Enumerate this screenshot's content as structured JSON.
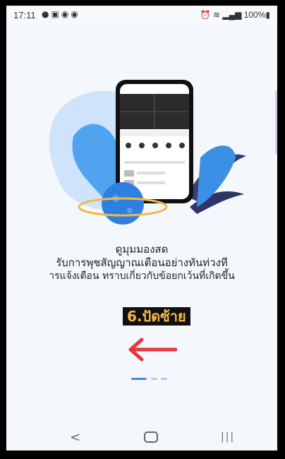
{
  "status_bar": {
    "time": "17:11",
    "left_icons": [
      "chat-icon",
      "gallery-icon",
      "app-icon",
      "app-icon"
    ],
    "right_icons": [
      "alarm-icon",
      "wifi-icon",
      "signal-icon"
    ],
    "battery": "100%"
  },
  "onboarding": {
    "line1": "ดูมุมมองสด",
    "line2": "รับการพุชสัญญาณเตือนอย่างทันท่วงที",
    "line3": "ารแจ้งเตือน ทราบเกี่ยวกับข้อยกเว้นที่เกิดขึ้น",
    "step_label": "6.ปัดซ้าย",
    "page_indicator": {
      "count": 3,
      "active": 1
    }
  },
  "colors": {
    "arrow": "#e8363c",
    "accent": "#3d8be0",
    "badge_bg": "#111111",
    "badge_text": "#f2b84a"
  },
  "nav_bar": {
    "buttons": [
      "back-icon",
      "home-icon",
      "recent-apps-icon"
    ]
  }
}
